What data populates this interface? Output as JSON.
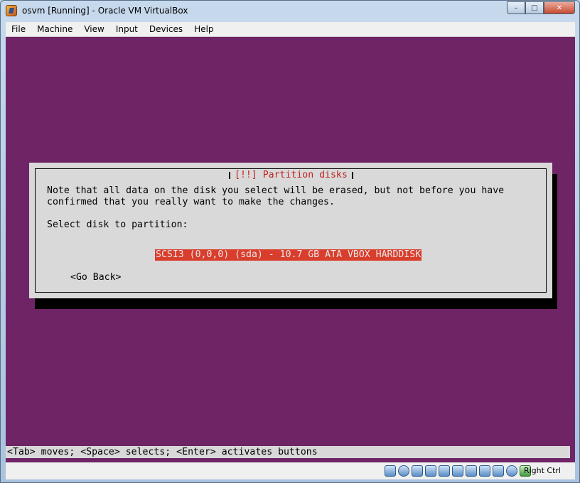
{
  "window": {
    "title": "osvm [Running] - Oracle VM VirtualBox",
    "controls": {
      "minimize": "–",
      "restore": "□",
      "close": "✕"
    }
  },
  "menubar": {
    "items": [
      "File",
      "Machine",
      "View",
      "Input",
      "Devices",
      "Help"
    ]
  },
  "installer": {
    "dialog_title": "[!!] Partition disks",
    "message_line1": "Note that all data on the disk you select will be erased, but not before you have",
    "message_line2": "confirmed that you really want to make the changes.",
    "prompt": "Select disk to partition:",
    "disk_option": "SCSI3 (0,0,0) (sda) - 10.7 GB ATA VBOX HARDDISK",
    "go_back": "<Go Back>",
    "footer_hint": "<Tab> moves; <Space> selects; <Enter> activates buttons"
  },
  "statusbar": {
    "icons": [
      "hard-disk-icon",
      "optical-drive-icon",
      "floppy-icon",
      "network-icon",
      "usb-icon",
      "shared-folders-icon",
      "display-icon",
      "video-capture-icon",
      "mouse-integration-icon",
      "cpu-icon",
      "host-key-indicator-icon"
    ],
    "host_key": "Right Ctrl"
  }
}
